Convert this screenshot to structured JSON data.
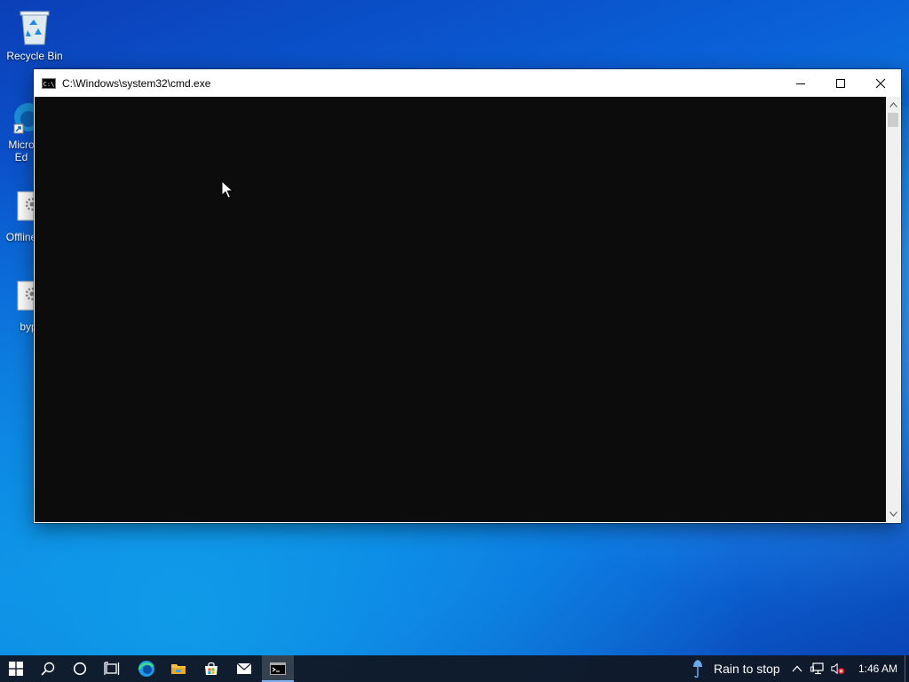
{
  "desktop": {
    "icons": [
      {
        "label": "Recycle Bin",
        "icon": "recycle-bin-icon"
      },
      {
        "label": "Micro\nEd",
        "icon": "edge-shortcut-icon"
      },
      {
        "label": "Offline",
        "icon": "settings-file-icon"
      },
      {
        "label": "byp",
        "icon": "settings-file-icon"
      }
    ]
  },
  "window": {
    "title": "C:\\Windows\\system32\\cmd.exe",
    "app_icon": "cmd-icon",
    "app_icon_text": "C:\\",
    "controls": {
      "minimize": "minimize-icon",
      "maximize": "maximize-icon",
      "close": "close-icon"
    },
    "console_text": "",
    "console_bg": "#0c0c0c"
  },
  "taskbar": {
    "items": [
      {
        "name": "start",
        "icon": "windows-logo-icon"
      },
      {
        "name": "search",
        "icon": "search-icon"
      },
      {
        "name": "cortana",
        "icon": "cortana-circle-icon"
      },
      {
        "name": "task-view",
        "icon": "task-view-icon"
      },
      {
        "name": "edge",
        "icon": "edge-icon"
      },
      {
        "name": "file-explorer",
        "icon": "folder-icon"
      },
      {
        "name": "store",
        "icon": "store-bag-icon"
      },
      {
        "name": "mail",
        "icon": "mail-icon"
      },
      {
        "name": "cmd",
        "icon": "cmd-icon",
        "active": true
      }
    ],
    "weather_text": "Rain to stop",
    "clock": "1:46 AM",
    "tray_icons": [
      "chevron-up-icon",
      "network-icon",
      "volume-muted-icon"
    ]
  },
  "colors": {
    "taskbar_bg": "#101826",
    "titlebar_bg": "#ffffff",
    "accent": "#7fb4f0"
  }
}
